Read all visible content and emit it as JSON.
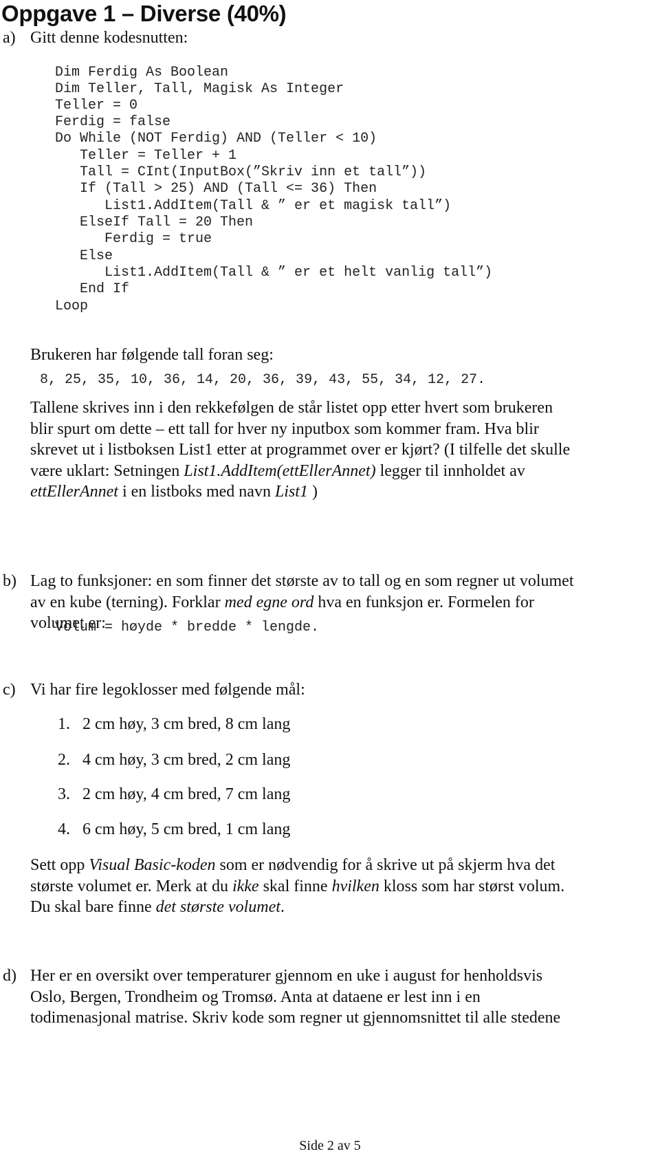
{
  "page": {
    "title": "Oppgave 1 – Diverse (40%)",
    "footer": "Side 2 av 5"
  },
  "a": {
    "label": "a)",
    "intro": "Gitt denne kodesnutten:",
    "code": [
      "Dim Ferdig As Boolean",
      "Dim Teller, Tall, Magisk As Integer",
      "Teller = 0",
      "Ferdig = false",
      "Do While (NOT Ferdig) AND (Teller < 10)",
      "   Teller = Teller + 1",
      "   Tall = CInt(InputBox(”Skriv inn et tall”))",
      "   If (Tall > 25) AND (Tall <= 36) Then",
      "      List1.AddItem(Tall & ” er et magisk tall”)",
      "   ElseIf Tall = 20 Then",
      "      Ferdig = true",
      "   Else",
      "      List1.AddItem(Tall & ” er et helt vanlig tall”)",
      "   End If",
      "Loop"
    ],
    "numbers_intro": "Brukeren har følgende tall foran seg:",
    "numbers": "8, 25, 35, 10, 36, 14, 20, 36, 39, 43, 55, 34, 12, 27.",
    "question_lines": [
      [
        "Tallene skrives inn i den rekkefølgen de står listet opp etter hvert som brukeren"
      ],
      [
        "blir spurt om dette – ett tall for hver ny inputbox som kommer fram. Hva blir"
      ],
      [
        "skrevet ut i listboksen List1 etter at programmet over er kjørt? (I tilfelle det skulle"
      ]
    ],
    "q4_pre": "være uklart: Setningen ",
    "q4_italic": "List1.AddItem(ettEllerAnnet)",
    "q4_post": " legger til innholdet av",
    "q5_italic1": "ettEllerAnnet",
    "q5_mid": " i en listboks med navn ",
    "q5_italic2": "List1",
    "q5_post": " )"
  },
  "b": {
    "label": "b)",
    "line1": "Lag to funksjoner: en som finner det største av to tall og en som regner ut volumet",
    "line2_pre": "av en kube (terning). Forklar ",
    "line2_italic": "med egne ord",
    "line2_post": " hva en funksjon er. Formelen for",
    "line3": "volumet er:",
    "formula": "Volum = høyde * bredde * lengde."
  },
  "c": {
    "label": "c)",
    "intro": "Vi har fire legoklosser med følgende mål:",
    "items": [
      {
        "num": "1.",
        "text": "2 cm høy, 3 cm bred, 8 cm lang"
      },
      {
        "num": "2.",
        "text": "4 cm høy, 3 cm bred, 2 cm lang"
      },
      {
        "num": "3.",
        "text": "2 cm høy, 4 cm bred, 7 cm lang"
      },
      {
        "num": "4.",
        "text": "6 cm høy, 5 cm bred, 1 cm lang"
      }
    ],
    "l1_pre": "Sett opp ",
    "l1_italic": "Visual Basic-koden",
    "l1_post": " som er nødvendig for å skrive ut på skjerm hva det",
    "l2_pre": "største volumet er. Merk at du ",
    "l2_italic1": "ikke",
    "l2_mid": " skal finne ",
    "l2_italic2": "hvilken",
    "l2_post": " kloss som har størst volum.",
    "l3_pre": "Du skal bare finne ",
    "l3_italic": "det største volumet",
    "l3_post": "."
  },
  "d": {
    "label": "d)",
    "lines": [
      "Her er en oversikt over temperaturer gjennom en uke i august for henholdsvis",
      "Oslo, Bergen, Trondheim og Tromsø. Anta at dataene er lest inn i en",
      "todimenasjonal matrise. Skriv kode som regner ut gjennomsnittet til alle stedene"
    ]
  }
}
